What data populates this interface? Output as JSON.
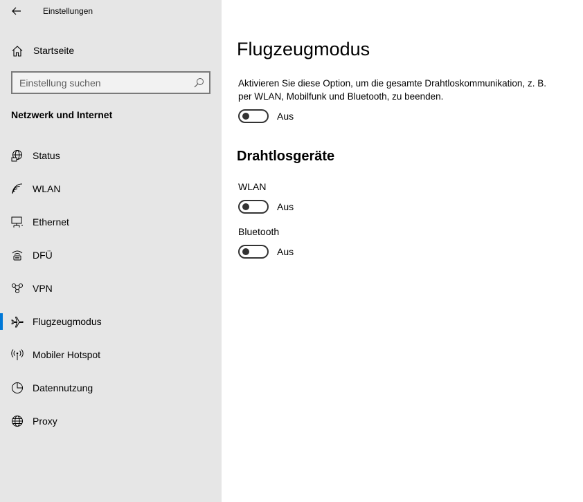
{
  "window": {
    "title": "Einstellungen"
  },
  "sidebar": {
    "home_label": "Startseite",
    "search_placeholder": "Einstellung suchen",
    "section_title": "Netzwerk und Internet",
    "items": [
      {
        "label": "Status",
        "icon": "globe-network-icon",
        "selected": false
      },
      {
        "label": "WLAN",
        "icon": "wifi-icon",
        "selected": false
      },
      {
        "label": "Ethernet",
        "icon": "ethernet-icon",
        "selected": false
      },
      {
        "label": "DFÜ",
        "icon": "dialup-icon",
        "selected": false
      },
      {
        "label": "VPN",
        "icon": "vpn-icon",
        "selected": false
      },
      {
        "label": "Flugzeugmodus",
        "icon": "airplane-icon",
        "selected": true
      },
      {
        "label": "Mobiler Hotspot",
        "icon": "hotspot-icon",
        "selected": false
      },
      {
        "label": "Datennutzung",
        "icon": "data-usage-icon",
        "selected": false
      },
      {
        "label": "Proxy",
        "icon": "globe-icon",
        "selected": false
      }
    ]
  },
  "main": {
    "title": "Flugzeugmodus",
    "description": "Aktivieren Sie diese Option, um die gesamte Drahtloskommunikation, z. B. per WLAN, Mobilfunk und Bluetooth, zu beenden.",
    "airplane_toggle": {
      "state": "Aus",
      "on": false
    },
    "wireless_heading": "Drahtlosgeräte",
    "wlan": {
      "label": "WLAN",
      "state": "Aus",
      "on": false
    },
    "bluetooth": {
      "label": "Bluetooth",
      "state": "Aus",
      "on": false
    }
  },
  "colors": {
    "accent": "#0078d7",
    "sidebar_bg": "#e6e6e6",
    "toggle_off": "#333333"
  }
}
